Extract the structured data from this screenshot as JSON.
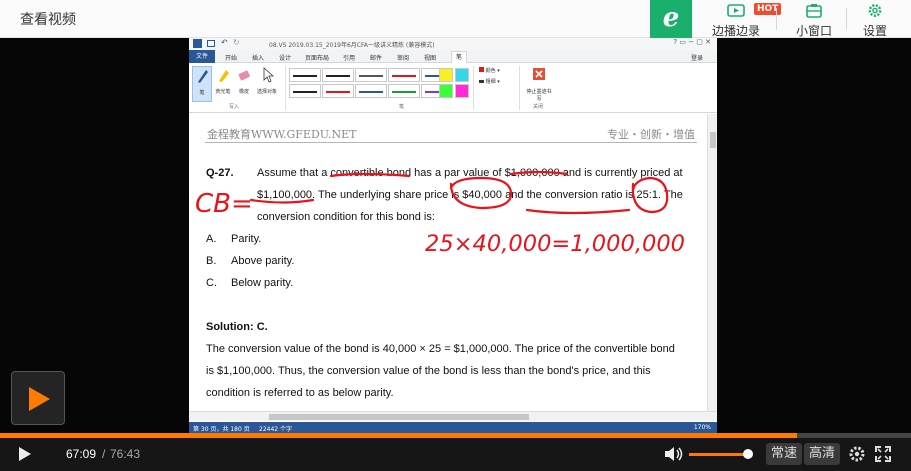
{
  "topbar": {
    "title": "查看视频",
    "buttons": {
      "live": "边播边录",
      "mini": "小窗口",
      "settings": "设置"
    },
    "hot_badge": "HOT",
    "logo_letter": "e"
  },
  "word": {
    "doc_title": "08.VS 2019.03.15_2019年6月CFA一级讲义精炼 (兼容模式)",
    "account": "登录",
    "tabs": [
      "文件",
      "开始",
      "插入",
      "设计",
      "页面布局",
      "引用",
      "邮件",
      "审阅",
      "视图",
      "笔"
    ],
    "tools": {
      "pen": "笔",
      "highlighter": "荧光笔",
      "eraser": "橡皮",
      "select": "选择对象",
      "color": "颜色",
      "thickness": "粗细",
      "stop": "停止墨迹书写"
    },
    "groups": {
      "write": "写入",
      "pens": "笔",
      "close": "关闭"
    },
    "status": {
      "page": "第 30 页，共 180 页",
      "words": "22442 个字",
      "zoom": "170%"
    }
  },
  "doc": {
    "header_left": "金程教育WWW.GFEDU.NET",
    "header_right": "专业・创新・增值",
    "q_number": "Q-27.",
    "q_line1": "Assume that a convertible bond has a par value of $1,000,000 and is currently priced at",
    "q_line2": "$1,100,000. The underlying share price is $40,000 and the conversion ratio is 25:1. The",
    "q_line3": "conversion condition for this bond is:",
    "options": [
      {
        "letter": "A.",
        "text": "Parity."
      },
      {
        "letter": "B.",
        "text": "Above parity."
      },
      {
        "letter": "C.",
        "text": "Below parity."
      }
    ],
    "solution_label": "Solution: C.",
    "sol_line1": "The conversion value of the bond is 40,000 × 25 = $1,000,000. The price of the convertible bond",
    "sol_line2": "is $1,100,000. Thus, the conversion value of the bond is less than the bond's price, and this",
    "sol_line3": "condition is referred to as below parity."
  },
  "annotations": {
    "cb_note": "CB=",
    "calc_note": "25×40,000=1,000,000",
    "ink_color": "#e8141c"
  },
  "player": {
    "current_time": "67:09",
    "total_time": "76:43",
    "progress_fraction": 0.875,
    "volume_fraction": 0.95,
    "speed_label": "常速",
    "quality_label": "高清",
    "accent_color": "#ff7a00"
  }
}
